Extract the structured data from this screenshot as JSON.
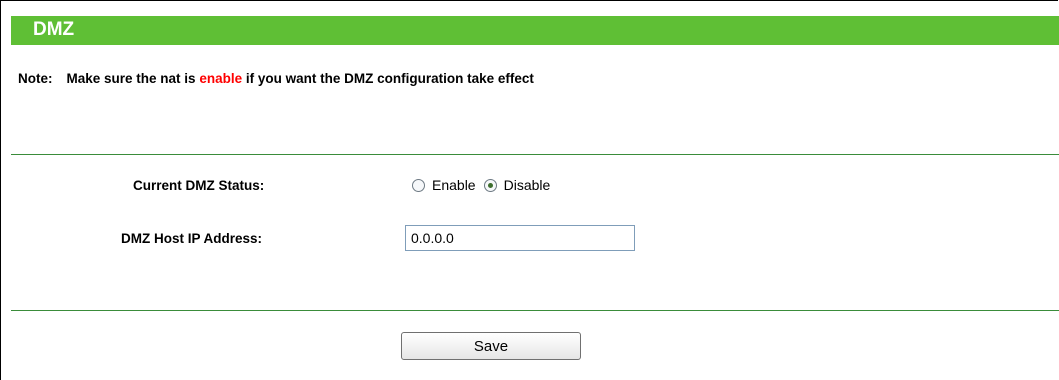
{
  "page": {
    "title": "DMZ"
  },
  "note": {
    "label": "Note:",
    "text_before": "Make sure the nat is ",
    "highlight": "enable",
    "text_after": " if you want the DMZ configuration take effect"
  },
  "form": {
    "status_label": "Current DMZ Status:",
    "status_options": [
      {
        "label": "Enable",
        "selected": false
      },
      {
        "label": "Disable",
        "selected": true
      }
    ],
    "ip_label": "DMZ Host IP Address:",
    "ip_value": "0.0.0.0"
  },
  "actions": {
    "save_label": "Save"
  },
  "colors": {
    "title_bar": "#5fbf35",
    "rule": "#3a8c3a",
    "highlight": "#ff0000"
  }
}
